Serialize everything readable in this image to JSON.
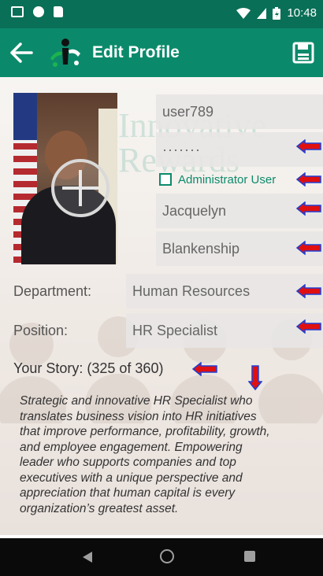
{
  "status_bar": {
    "time": "10:48",
    "icons": [
      "gallery-icon",
      "record-icon",
      "sd-card-icon",
      "wifi-icon",
      "signal-icon",
      "battery-icon"
    ]
  },
  "toolbar": {
    "title": "Edit Profile",
    "back_icon": "arrow-left-icon",
    "logo_icon": "app-logo-icon",
    "save_icon": "save-disk-icon",
    "color": "#0b8a6b"
  },
  "background": {
    "watermark": "Innovative\nRewards"
  },
  "profile": {
    "photo_icon": "add-photo-icon",
    "username": "user789",
    "password": "·······",
    "admin_checkbox_label": "Administrator User",
    "admin_checked": false,
    "first_name": "Jacquelyn",
    "last_name": "Blankenship",
    "department_label": "Department:",
    "department": "Human Resources",
    "position_label": "Position:",
    "position": "HR Specialist",
    "story_label": "Your Story:  (325 of 360)",
    "story": "Strategic and innovative HR Specialist who\ntranslates business vision into HR initiatives\nthat improve performance, profitability, growth,\nand employee engagement. Empowering\nleader who supports companies and top\nexecutives with a unique perspective and\nappreciation that human capital is every\norganization’s greatest asset."
  },
  "annotation_arrows": {
    "color": "#e01010",
    "outline": "#1f3fd6"
  },
  "nav_bar": {
    "icons": [
      "back-triangle-icon",
      "home-circle-icon",
      "recents-square-icon"
    ]
  }
}
